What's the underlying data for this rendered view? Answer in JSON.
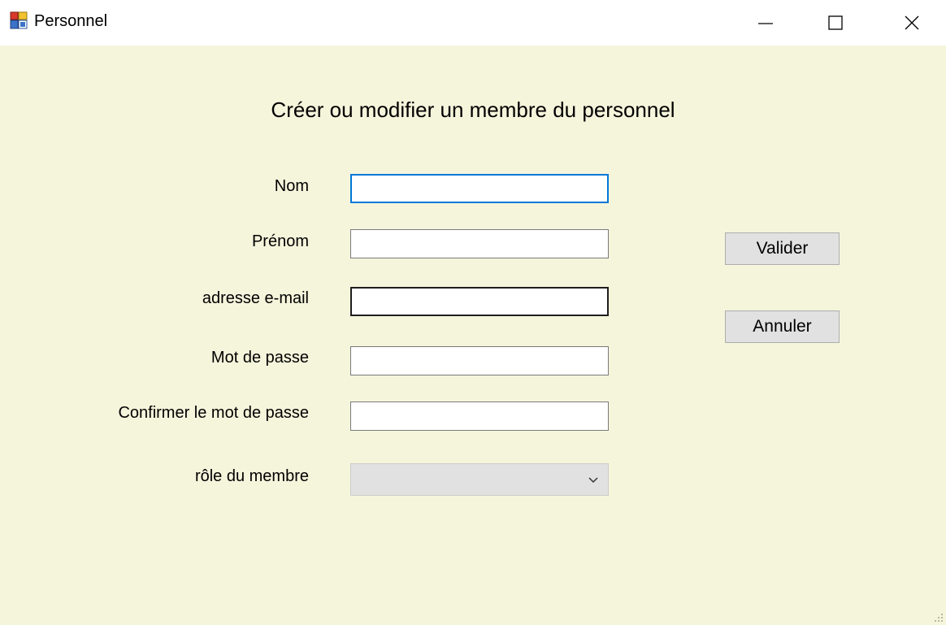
{
  "window": {
    "title": "Personnel",
    "controls": {
      "minimize": "minimize-icon",
      "maximize": "maximize-icon",
      "close": "close-icon"
    }
  },
  "form": {
    "title": "Créer ou modifier un membre du personnel",
    "fields": {
      "nom": {
        "label": "Nom",
        "value": ""
      },
      "prenom": {
        "label": "Prénom",
        "value": ""
      },
      "email": {
        "label": "adresse e-mail",
        "value": ""
      },
      "password": {
        "label": "Mot de passe",
        "value": ""
      },
      "confirm_password": {
        "label": "Confirmer le mot de passe",
        "value": ""
      },
      "role": {
        "label": "rôle du membre",
        "value": ""
      }
    }
  },
  "buttons": {
    "validate": "Valider",
    "cancel": "Annuler"
  },
  "colors": {
    "background": "#f5f5dc",
    "focus_border": "#0078d7",
    "button_face": "#e1e1e1"
  }
}
